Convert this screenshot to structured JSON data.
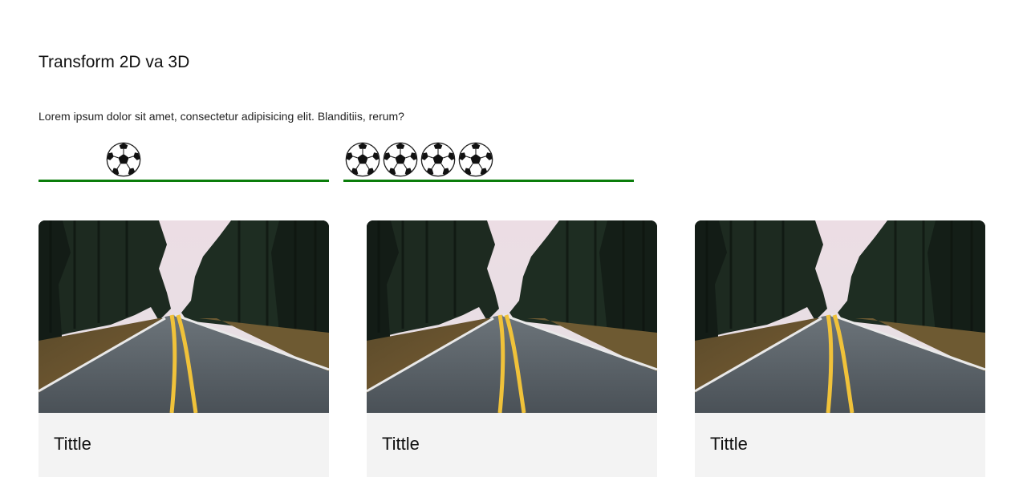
{
  "header": {
    "title": "Transform 2D va 3D",
    "description": "Lorem ipsum dolor sit amet, consectetur adipisicing elit. Blanditiis, rerum?"
  },
  "tracks": [
    {
      "balls": 1,
      "line_color": "#0a7d0a"
    },
    {
      "balls": 4,
      "line_color": "#0a7d0a"
    }
  ],
  "cards": [
    {
      "image": "forest-road-image",
      "title": "Tittle"
    },
    {
      "image": "forest-road-image",
      "title": "Tittle"
    },
    {
      "image": "forest-road-image",
      "title": "Tittle"
    }
  ],
  "colors": {
    "track_line": "#0a7d0a",
    "card_body": "#f3f3f3"
  }
}
